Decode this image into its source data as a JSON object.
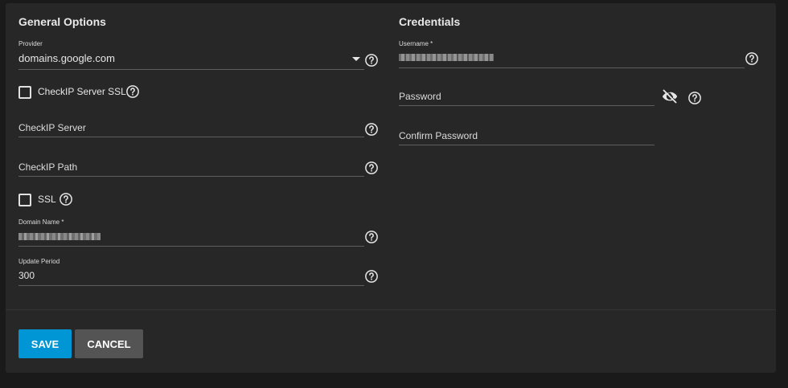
{
  "general": {
    "title": "General Options",
    "provider": {
      "label": "Provider",
      "value": "domains.google.com"
    },
    "checkip_ssl": {
      "label": "CheckIP Server SSL",
      "checked": false
    },
    "checkip_server": {
      "placeholder": "CheckIP Server"
    },
    "checkip_path": {
      "placeholder": "CheckIP Path"
    },
    "ssl": {
      "label": "SSL",
      "checked": false
    },
    "domain_name": {
      "label": "Domain Name *"
    },
    "update_period": {
      "label": "Update Period",
      "value": "300"
    }
  },
  "credentials": {
    "title": "Credentials",
    "username": {
      "label": "Username *"
    },
    "password": {
      "placeholder": "Password"
    },
    "confirm_password": {
      "placeholder": "Confirm Password"
    }
  },
  "actions": {
    "save_label": "SAVE",
    "cancel_label": "CANCEL"
  },
  "icons": {
    "help": "help-circle-icon",
    "visibility": "eye-off-icon",
    "dropdown": "arrow-drop-down-icon"
  },
  "colors": {
    "background": "#1a1a1a",
    "card": "#272727",
    "primary": "#0095d5",
    "cancel": "#545454",
    "text": "#e6e6e6"
  }
}
